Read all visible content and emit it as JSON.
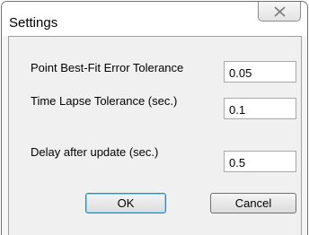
{
  "window": {
    "title": "Settings"
  },
  "fields": [
    {
      "label": "Point Best-Fit Error Tolerance",
      "value": "0.05"
    },
    {
      "label": "Time Lapse Tolerance (sec.)",
      "value": "0.1"
    },
    {
      "label": "Delay after update (sec.)",
      "value": "0.5"
    }
  ],
  "buttons": {
    "ok_label": "OK",
    "cancel_label": "Cancel"
  },
  "icons": {
    "close": "close-icon"
  }
}
